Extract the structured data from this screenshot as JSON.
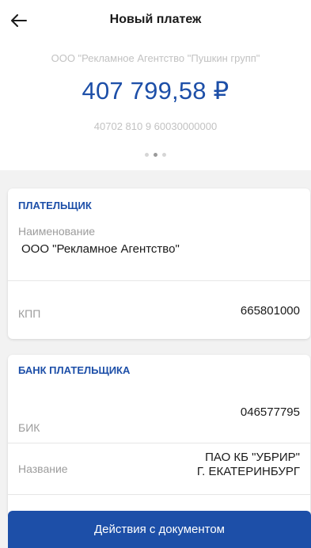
{
  "header": {
    "title": "Новый платеж",
    "back_icon": "arrow-left-icon"
  },
  "summary": {
    "recipient": "ООО \"Рекламное Агентство \"Пушкин групп\"",
    "amount": "407 799,58 ₽",
    "account": "40702 810 9 60030000000",
    "pager": {
      "total": 3,
      "active_index": 1
    }
  },
  "payer": {
    "section_title": "ПЛАТЕЛЬЩИК",
    "name_label": "Наименование",
    "name_value": "ООО \"Рекламное Агентство\"",
    "kpp_label": "КПП",
    "kpp_value": "665801000"
  },
  "payer_bank": {
    "section_title": "БАНК ПЛАТЕЛЬЩИКА",
    "bik_label": "БИК",
    "bik_value": "046577795",
    "name_label": "Название",
    "name_value_line1": "ПАО КБ \"УБРИР\"",
    "name_value_line2": "Г. ЕКАТЕРИНБУРГ"
  },
  "actions": {
    "documents_button": "Действия с документом"
  },
  "colors": {
    "accent": "#1d4fa8",
    "muted_text": "#c2c2c2",
    "background": "#f2f2f2"
  }
}
